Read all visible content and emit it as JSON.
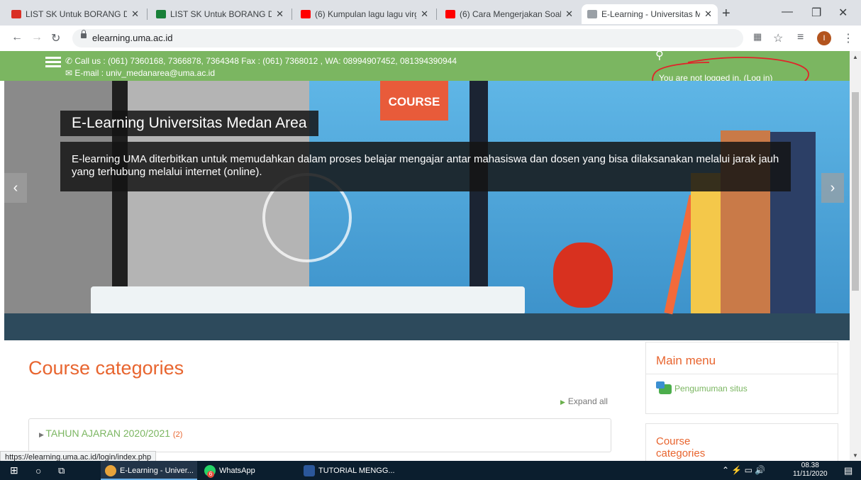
{
  "browser": {
    "tabs": [
      {
        "label": "LIST SK Untuk BORANG DIKTI",
        "icon": "gmail-icon",
        "active": false
      },
      {
        "label": "LIST SK Untuk BORANG DIKTI",
        "icon": "sheets-icon",
        "active": false
      },
      {
        "label": "(6) Kumpulan lagu lagu virgou",
        "icon": "youtube-icon",
        "active": false
      },
      {
        "label": "(6) Cara Mengerjakan Soal UTS",
        "icon": "youtube-icon",
        "active": false
      },
      {
        "label": "E-Learning - Universitas Meda",
        "icon": "site-icon",
        "active": true
      }
    ],
    "url": "elearning.uma.ac.id",
    "avatar_initial": "I",
    "status_url": "https://elearning.uma.ac.id/login/index.php"
  },
  "topbar": {
    "contact_line1": "Call us : (061) 7360168, 7366878, 7364348 Fax : (061) 7368012 , WA: 08994907452, 081394390944",
    "contact_line2": "E-mail : univ_medanarea@uma.ac.id",
    "login_text": "You are not logged in.",
    "login_link": "(Log in)"
  },
  "hero": {
    "badge": "COURSE",
    "title": "E-Learning Universitas Medan Area",
    "description": "E-learning UMA diterbitkan untuk memudahkan dalam proses belajar mengajar antar mahasiswa dan dosen yang bisa dilaksanakan melalui jarak jauh yang terhubung melalui internet (online)."
  },
  "main": {
    "heading": "Course categories",
    "expand_all": "Expand all",
    "categories": [
      {
        "name": "TAHUN AJARAN 2020/2021",
        "count": "(2)"
      }
    ]
  },
  "sidebar": {
    "main_menu_title": "Main menu",
    "main_menu_items": [
      "Pengumuman situs"
    ],
    "course_categories_title": "Course categories"
  },
  "taskbar": {
    "items": [
      "E-Learning - Univer...",
      "WhatsApp",
      "TUTORIAL MENGG..."
    ],
    "whatsapp_badge": "6",
    "time": "08.38",
    "date": "11/11/2020"
  },
  "colors": {
    "green": "#7bb661",
    "orange": "#e8652f"
  }
}
